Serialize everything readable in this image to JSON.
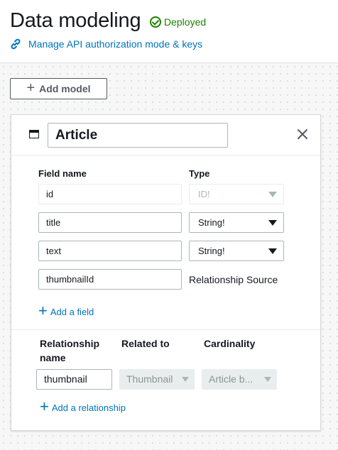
{
  "header": {
    "title": "Data modeling",
    "status": "Deployed",
    "manage_link": "Manage API authorization mode & keys"
  },
  "toolbar": {
    "add_model_label": "Add model"
  },
  "model": {
    "name": "Article",
    "field_name_header": "Field name",
    "type_header": "Type",
    "fields": [
      {
        "name": "id",
        "type": "ID!"
      },
      {
        "name": "title",
        "type": "String!"
      },
      {
        "name": "text",
        "type": "String!"
      },
      {
        "name": "thumbnailId",
        "type": "Relationship Source"
      }
    ],
    "add_field_label": "Add a field",
    "relationship_name_header": "Relationship name",
    "related_to_header": "Related to",
    "cardinality_header": "Cardinality",
    "relationships": [
      {
        "name": "thumbnail",
        "related_to": "Thumbnail",
        "cardinality": "Article b..."
      }
    ],
    "add_relationship_label": "Add a relationship"
  },
  "colors": {
    "link": "#0073bb",
    "success": "#1d8102",
    "text": "#16191f"
  }
}
